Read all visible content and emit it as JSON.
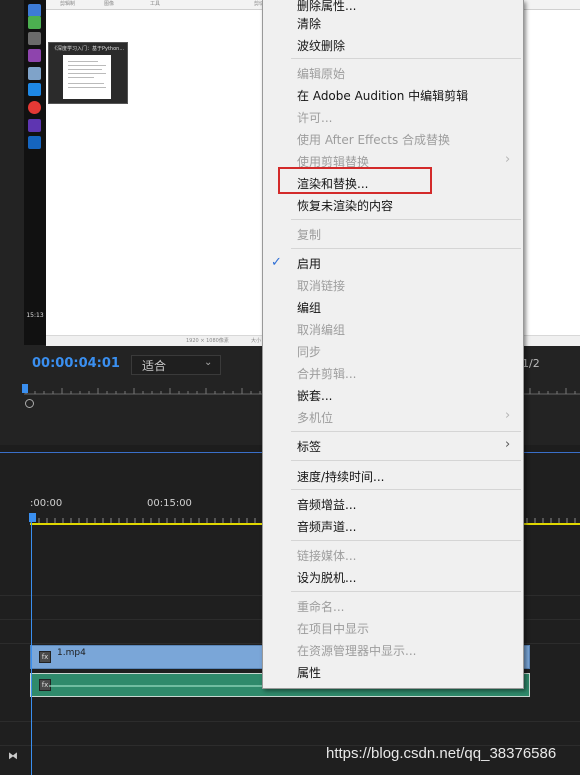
{
  "program_monitor": {
    "timecode": "00:00:04:01",
    "fit_select": "适合",
    "page_ratio": "1/2"
  },
  "desktop_preview": {
    "header_columns": [
      "剪辑制",
      "图像",
      "工具",
      "剪切"
    ],
    "thumbnail_title": "《深度学习入门：基于Python...",
    "taskbar_time": "15:13",
    "footer_text": [
      "1920 × 1080像素",
      "大小"
    ]
  },
  "timeline": {
    "timecodes": [
      ":00:00",
      "00:15:00"
    ],
    "video_clip_name": "1.mp4",
    "fx_label": "fx"
  },
  "context_menu": {
    "items": [
      {
        "label": "删除属性...",
        "enabled": true
      },
      {
        "label": "清除",
        "enabled": true
      },
      {
        "label": "波纹删除",
        "enabled": true
      },
      {
        "label": "编辑原始",
        "enabled": false
      },
      {
        "label": "在 Adobe Audition 中编辑剪辑",
        "enabled": true
      },
      {
        "label": "许可...",
        "enabled": false
      },
      {
        "label": "使用 After Effects 合成替换",
        "enabled": false
      },
      {
        "label": "使用剪辑替换",
        "enabled": false,
        "submenu": true
      },
      {
        "label": "渲染和替换...",
        "enabled": true
      },
      {
        "label": "恢复未渲染的内容",
        "enabled": true
      },
      {
        "label": "复制",
        "enabled": false
      },
      {
        "label": "启用",
        "enabled": true,
        "checked": true
      },
      {
        "label": "取消链接",
        "enabled": false
      },
      {
        "label": "编组",
        "enabled": true
      },
      {
        "label": "取消编组",
        "enabled": false
      },
      {
        "label": "同步",
        "enabled": false
      },
      {
        "label": "合并剪辑...",
        "enabled": false
      },
      {
        "label": "嵌套...",
        "enabled": true
      },
      {
        "label": "多机位",
        "enabled": false,
        "submenu": true
      },
      {
        "label": "标签",
        "enabled": true,
        "submenu": true
      },
      {
        "label": "速度/持续时间...",
        "enabled": true
      },
      {
        "label": "音频增益...",
        "enabled": true
      },
      {
        "label": "音频声道...",
        "enabled": true
      },
      {
        "label": "链接媒体...",
        "enabled": false
      },
      {
        "label": "设为脱机...",
        "enabled": true
      },
      {
        "label": "重命名...",
        "enabled": false
      },
      {
        "label": "在项目中显示",
        "enabled": false
      },
      {
        "label": "在资源管理器中显示...",
        "enabled": false
      },
      {
        "label": "属性",
        "enabled": true
      }
    ],
    "submenu_arrow": "›",
    "check_mark": "✓",
    "highlighted_item": "渲染和替换..."
  },
  "watermark": "https://blog.csdn.net/qq_38376586",
  "colors": {
    "accent_blue": "#3a8ff0",
    "highlight_red": "#d32a2a",
    "menu_bg": "#f0f0f0",
    "video_clip": "#7aa6d8",
    "audio_clip": "#2f8a6b"
  }
}
